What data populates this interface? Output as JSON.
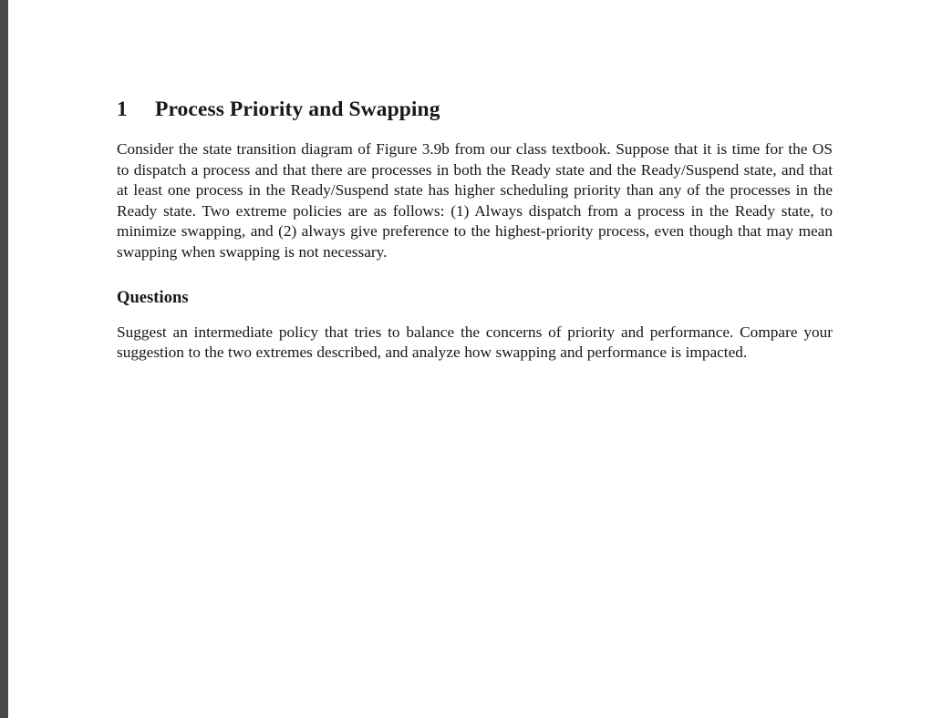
{
  "document": {
    "section": {
      "number": "1",
      "title": "Process Priority and Swapping",
      "paragraph": "Consider the state transition diagram of Figure 3.9b from our class textbook. Suppose that it is time for the OS to dispatch a process and that there are processes in both the Ready state and the Ready/Suspend state, and that at least one process in the Ready/Suspend state has higher scheduling priority than any of the processes in the Ready state. Two extreme policies are as follows: (1) Always dispatch from a process in the Ready state, to minimize swapping, and (2) always give preference to the highest-priority process, even though that may mean swapping when swapping is not necessary."
    },
    "subsection": {
      "title": "Questions",
      "paragraph": "Suggest an intermediate policy that tries to balance the concerns of priority and performance. Compare your suggestion to the two extremes described, and analyze how swapping and performance is impacted."
    }
  },
  "theme": {
    "page_background": "#ffffff",
    "gutter_color": "#474a4d",
    "text_color": "#15181c"
  }
}
